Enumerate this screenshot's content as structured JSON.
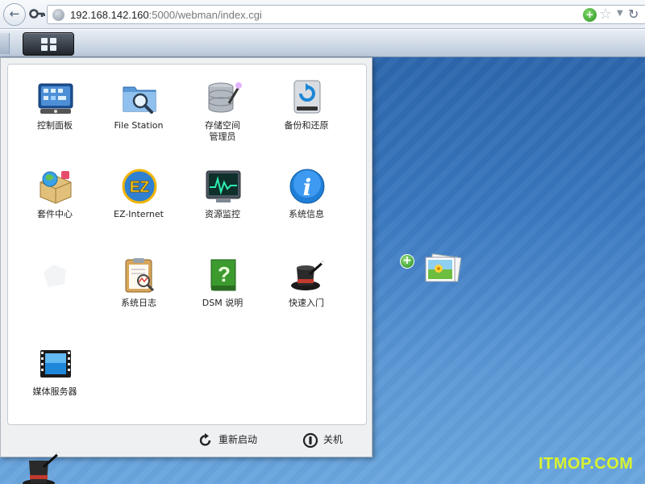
{
  "browser": {
    "back_label": "←",
    "url_host": "192.168.142.160",
    "url_path": ":5000/webman/index.cgi",
    "star_glyph": "☆",
    "dropdown_glyph": "▼",
    "reload_glyph": "↻",
    "go_glyph": "+"
  },
  "start_menu": {
    "apps": [
      {
        "label": "控制面板",
        "icon": "control-panel-icon"
      },
      {
        "label": "File Station",
        "icon": "file-station-icon"
      },
      {
        "label": "存储空间\n管理员",
        "icon": "storage-manager-icon"
      },
      {
        "label": "备份和还原",
        "icon": "backup-restore-icon"
      },
      {
        "label": "套件中心",
        "icon": "package-center-icon"
      },
      {
        "label": "EZ-Internet",
        "icon": "ez-internet-icon"
      },
      {
        "label": "资源监控",
        "icon": "resource-monitor-icon"
      },
      {
        "label": "系统信息",
        "icon": "system-info-icon"
      },
      {
        "label": "系统日志",
        "icon": "system-log-icon"
      },
      {
        "label": "DSM 说明",
        "icon": "dsm-help-icon"
      },
      {
        "label": "快速入门",
        "icon": "quick-start-icon"
      },
      {
        "label": "媒体服务器",
        "icon": "media-server-icon"
      }
    ],
    "restart_label": "重新启动",
    "shutdown_label": "关机"
  },
  "desktop": {
    "add_glyph": "+"
  },
  "watermark": "ITMOP.COM",
  "colors": {
    "desktop_top": "#2a63a8",
    "desktop_bottom": "#6aa6de",
    "watermark": "#d9f230"
  }
}
